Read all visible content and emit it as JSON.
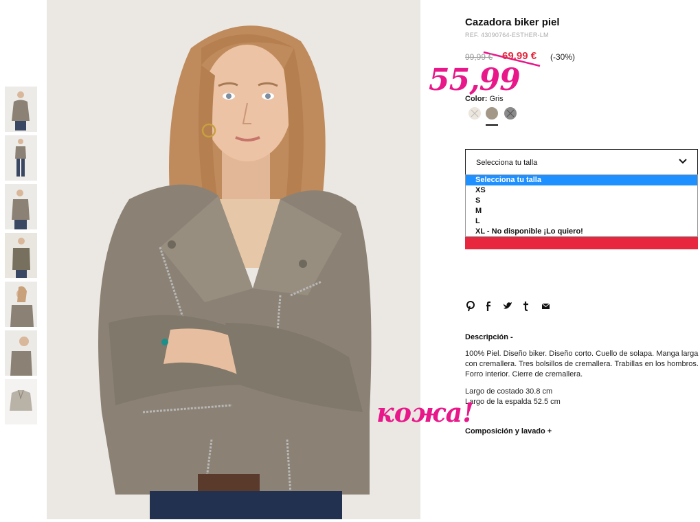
{
  "product": {
    "title": "Cazadora biker piel",
    "ref": "REF. 43090764-ESTHER-LM",
    "old_price": "99,99 €",
    "new_price": "69,99 €",
    "discount": "(-30%)"
  },
  "annotations": {
    "price_note": "55,99",
    "material_note": "кожа!",
    "color": "#e8178a"
  },
  "color": {
    "label": "Color:",
    "value": "Gris",
    "swatches": [
      {
        "name": "crema",
        "hex": "#ece6dd",
        "crossed": true
      },
      {
        "name": "gris",
        "hex": "#a39888",
        "selected": true
      },
      {
        "name": "gris-oscuro",
        "hex": "#8a8a8a",
        "crossed": true
      }
    ]
  },
  "size": {
    "select_label": "Selecciona tu talla",
    "options": [
      "Selecciona tu talla",
      "XS",
      "S",
      "M",
      "L",
      "XL - No disponible ¡Lo quiero!"
    ],
    "selected_index": 0
  },
  "social": {
    "icons": [
      "pinterest-icon",
      "facebook-icon",
      "twitter-icon",
      "tumblr-icon",
      "email-icon"
    ]
  },
  "description": {
    "title": "Descripción -",
    "text": "100% Piel. Diseño biker. Diseño corto. Cuello de solapa. Manga larga con cremallera. Tres bolsillos de cremallera. Trabillas en los hombros. Forro interior. Cierre de cremallera.",
    "measure_1": "Largo de costado 30.8 cm",
    "measure_2": "Largo de la espalda 52.5 cm"
  },
  "composition": {
    "title": "Composición y lavado +"
  },
  "colors": {
    "accent_red": "#e8263d",
    "price_red": "#e2273c",
    "select_highlight": "#1e90ff",
    "jacket": "#8b8275"
  }
}
